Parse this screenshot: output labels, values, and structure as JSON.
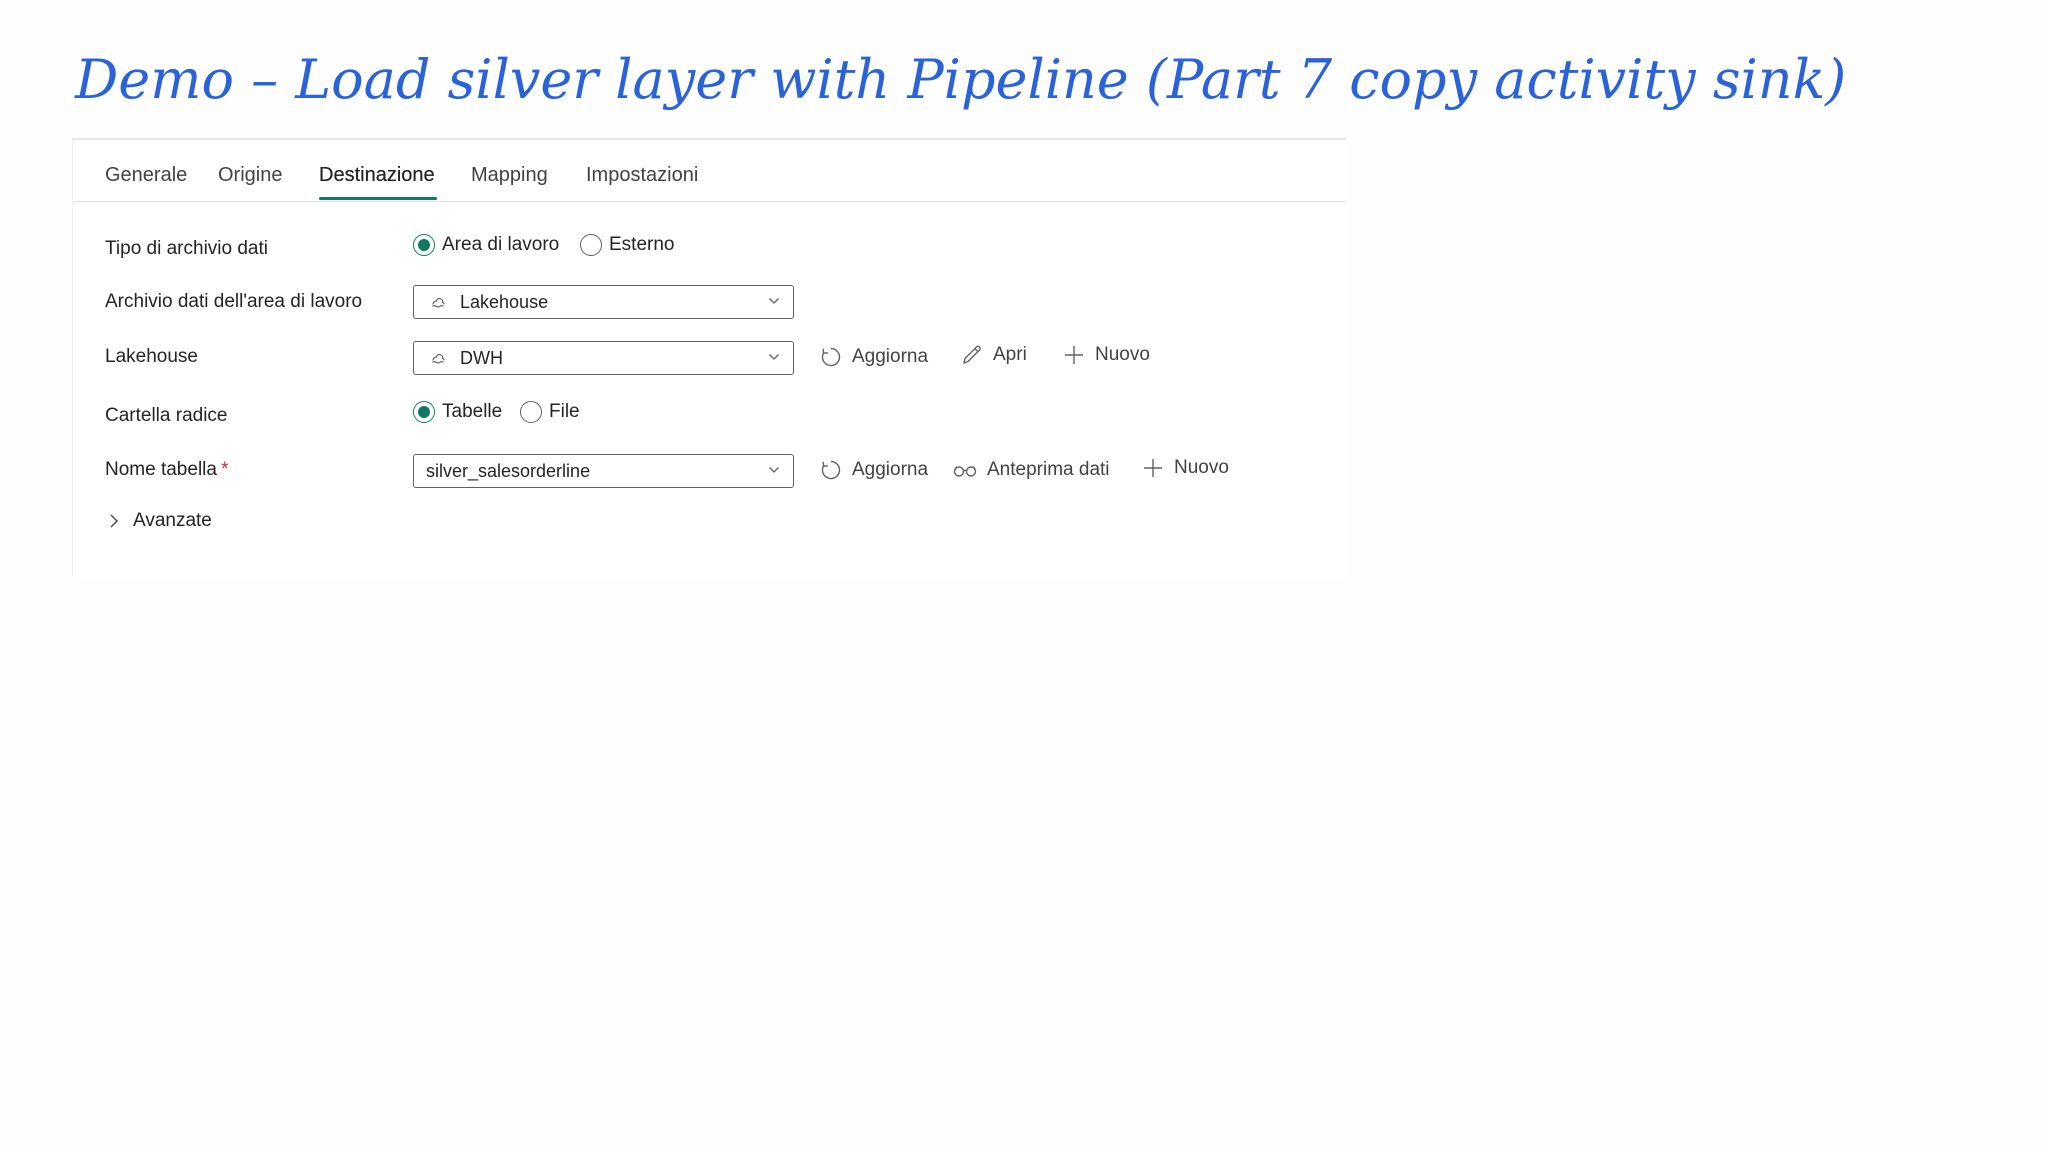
{
  "slide": {
    "title": "Demo – Load silver layer with Pipeline (Part 7 copy activity sink)"
  },
  "tabs": [
    {
      "label": "Generale",
      "active": false
    },
    {
      "label": "Origine",
      "active": false
    },
    {
      "label": "Destinazione",
      "active": true
    },
    {
      "label": "Mapping",
      "active": false
    },
    {
      "label": "Impostazioni",
      "active": false
    }
  ],
  "form": {
    "store_type": {
      "label": "Tipo di archivio dati",
      "options": [
        "Area di lavoro",
        "Esterno"
      ],
      "selected": "Area di lavoro"
    },
    "workspace_store": {
      "label": "Archivio dati dell'area di lavoro",
      "value": "Lakehouse",
      "icon": "lakehouse-icon"
    },
    "lakehouse": {
      "label": "Lakehouse",
      "value": "DWH",
      "icon": "lakehouse-icon",
      "actions": {
        "refresh": "Aggiorna",
        "open": "Apri",
        "new": "Nuovo"
      }
    },
    "root_folder": {
      "label": "Cartella radice",
      "options": [
        "Tabelle",
        "File"
      ],
      "selected": "Tabelle"
    },
    "table_name": {
      "label": "Nome tabella",
      "required_mark": "*",
      "value": "silver_salesorderline",
      "actions": {
        "refresh": "Aggiorna",
        "preview": "Anteprima dati",
        "new": "Nuovo"
      }
    },
    "advanced": {
      "label": "Avanzate"
    }
  },
  "colors": {
    "title": "#2a63d8",
    "accent": "#117865",
    "required": "#c4314b"
  }
}
